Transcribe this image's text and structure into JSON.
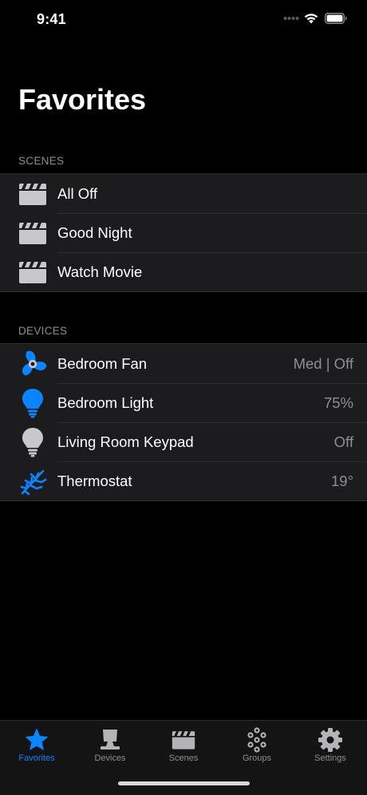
{
  "status": {
    "time": "9:41"
  },
  "page": {
    "title": "Favorites"
  },
  "scenes": {
    "header": "SCENES",
    "items": [
      {
        "label": "All Off",
        "icon": "clapperboard-icon"
      },
      {
        "label": "Good Night",
        "icon": "clapperboard-icon"
      },
      {
        "label": "Watch Movie",
        "icon": "clapperboard-icon"
      }
    ]
  },
  "devices": {
    "header": "DEVICES",
    "items": [
      {
        "label": "Bedroom Fan",
        "value": "Med | Off",
        "icon": "fan-icon"
      },
      {
        "label": "Bedroom Light",
        "value": "75%",
        "icon": "lightbulb-icon"
      },
      {
        "label": "Living Room Keypad",
        "value": "Off",
        "icon": "lightbulb-icon"
      },
      {
        "label": "Thermostat",
        "value": "19°",
        "icon": "snowflake-icon"
      }
    ]
  },
  "tabs": [
    {
      "label": "Favorites",
      "icon": "star-icon",
      "active": true
    },
    {
      "label": "Devices",
      "icon": "lamp-icon",
      "active": false
    },
    {
      "label": "Scenes",
      "icon": "clapperboard-icon",
      "active": false
    },
    {
      "label": "Groups",
      "icon": "groups-icon",
      "active": false
    },
    {
      "label": "Settings",
      "icon": "gear-icon",
      "active": false
    }
  ],
  "colors": {
    "accent": "#0a84ff",
    "background": "#000000",
    "cell": "#1c1c1e",
    "secondary_text": "#8e8e93",
    "inactive_icon": "#b4b4b8"
  }
}
